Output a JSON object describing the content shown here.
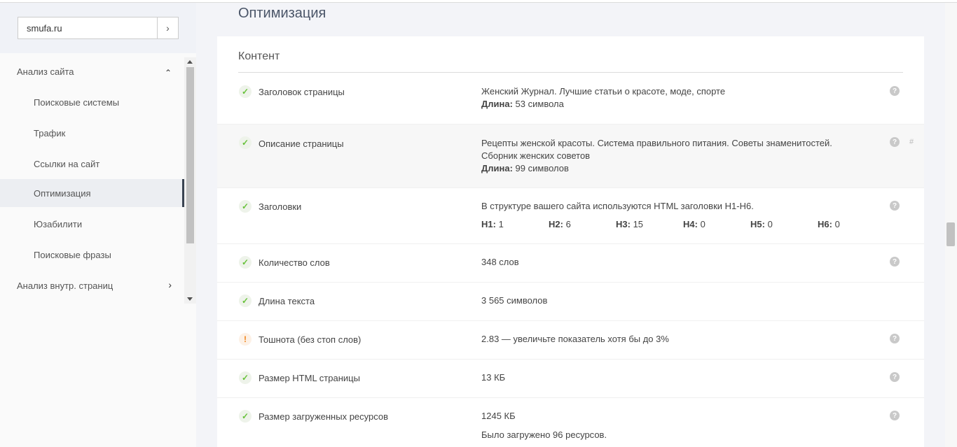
{
  "sidebar": {
    "site_value": "smufa.ru",
    "go_glyph": "›",
    "items": [
      {
        "label": "Анализ сайта",
        "chevron": "⌃",
        "level": 0
      },
      {
        "label": "Поисковые системы",
        "level": 1
      },
      {
        "label": "Трафик",
        "level": 1
      },
      {
        "label": "Ссылки на сайт",
        "level": 1
      },
      {
        "label": "Оптимизация",
        "level": 1,
        "active": true
      },
      {
        "label": "Юзабилити",
        "level": 1
      },
      {
        "label": "Поисковые фразы",
        "level": 1
      },
      {
        "label": "Анализ внутр. страниц",
        "chevron": "›",
        "level": 0
      }
    ]
  },
  "main": {
    "page_title": "Оптимизация",
    "section_title": "Контент",
    "rows": [
      {
        "status": "ok",
        "label": "Заголовок страницы",
        "line1": "Женский Журнал. Лучшие статьи о красоте, моде, спорте",
        "len_label": "Длина:",
        "len_value": " 53 символа"
      },
      {
        "status": "ok",
        "label": "Описание страницы",
        "line1": "Рецепты женской красоты. Система правильного питания. Советы знаменитостей.",
        "line2": "Сборник женских советов",
        "len_label": "Длина:",
        "len_value": " 99 символов",
        "anchor": "#"
      },
      {
        "status": "ok",
        "label": "Заголовки",
        "line1": "В структуре вашего сайта используются HTML заголовки H1-H6.",
        "headings": [
          {
            "tag": "H1:",
            "value": " 1"
          },
          {
            "tag": "H2:",
            "value": " 6"
          },
          {
            "tag": "H3:",
            "value": " 15"
          },
          {
            "tag": "H4:",
            "value": " 0"
          },
          {
            "tag": "H5:",
            "value": " 0"
          },
          {
            "tag": "H6:",
            "value": " 0"
          }
        ]
      },
      {
        "status": "ok",
        "label": "Количество слов",
        "line1": "348 слов"
      },
      {
        "status": "ok",
        "label": "Длина текста",
        "line1": "3 565 символов"
      },
      {
        "status": "warn",
        "label": "Тошнота (без стоп слов)",
        "line1": "2.83 — увеличьте показатель хотя бы до 3%"
      },
      {
        "status": "ok",
        "label": "Размер HTML страницы",
        "line1": "13 КБ"
      },
      {
        "status": "ok",
        "label": "Размер загруженных ресурсов",
        "line1": "1245 КБ",
        "line2": "Было загружено 96 ресурсов."
      }
    ]
  },
  "icons": {
    "ok": "check-icon",
    "warn": "exclamation-icon",
    "ok_glyph": "✓",
    "warn_glyph": "!",
    "help_glyph": "?"
  },
  "colors": {
    "ok": "#67c23a",
    "warn": "#f0851a",
    "active_indicator": "#3a4452"
  }
}
